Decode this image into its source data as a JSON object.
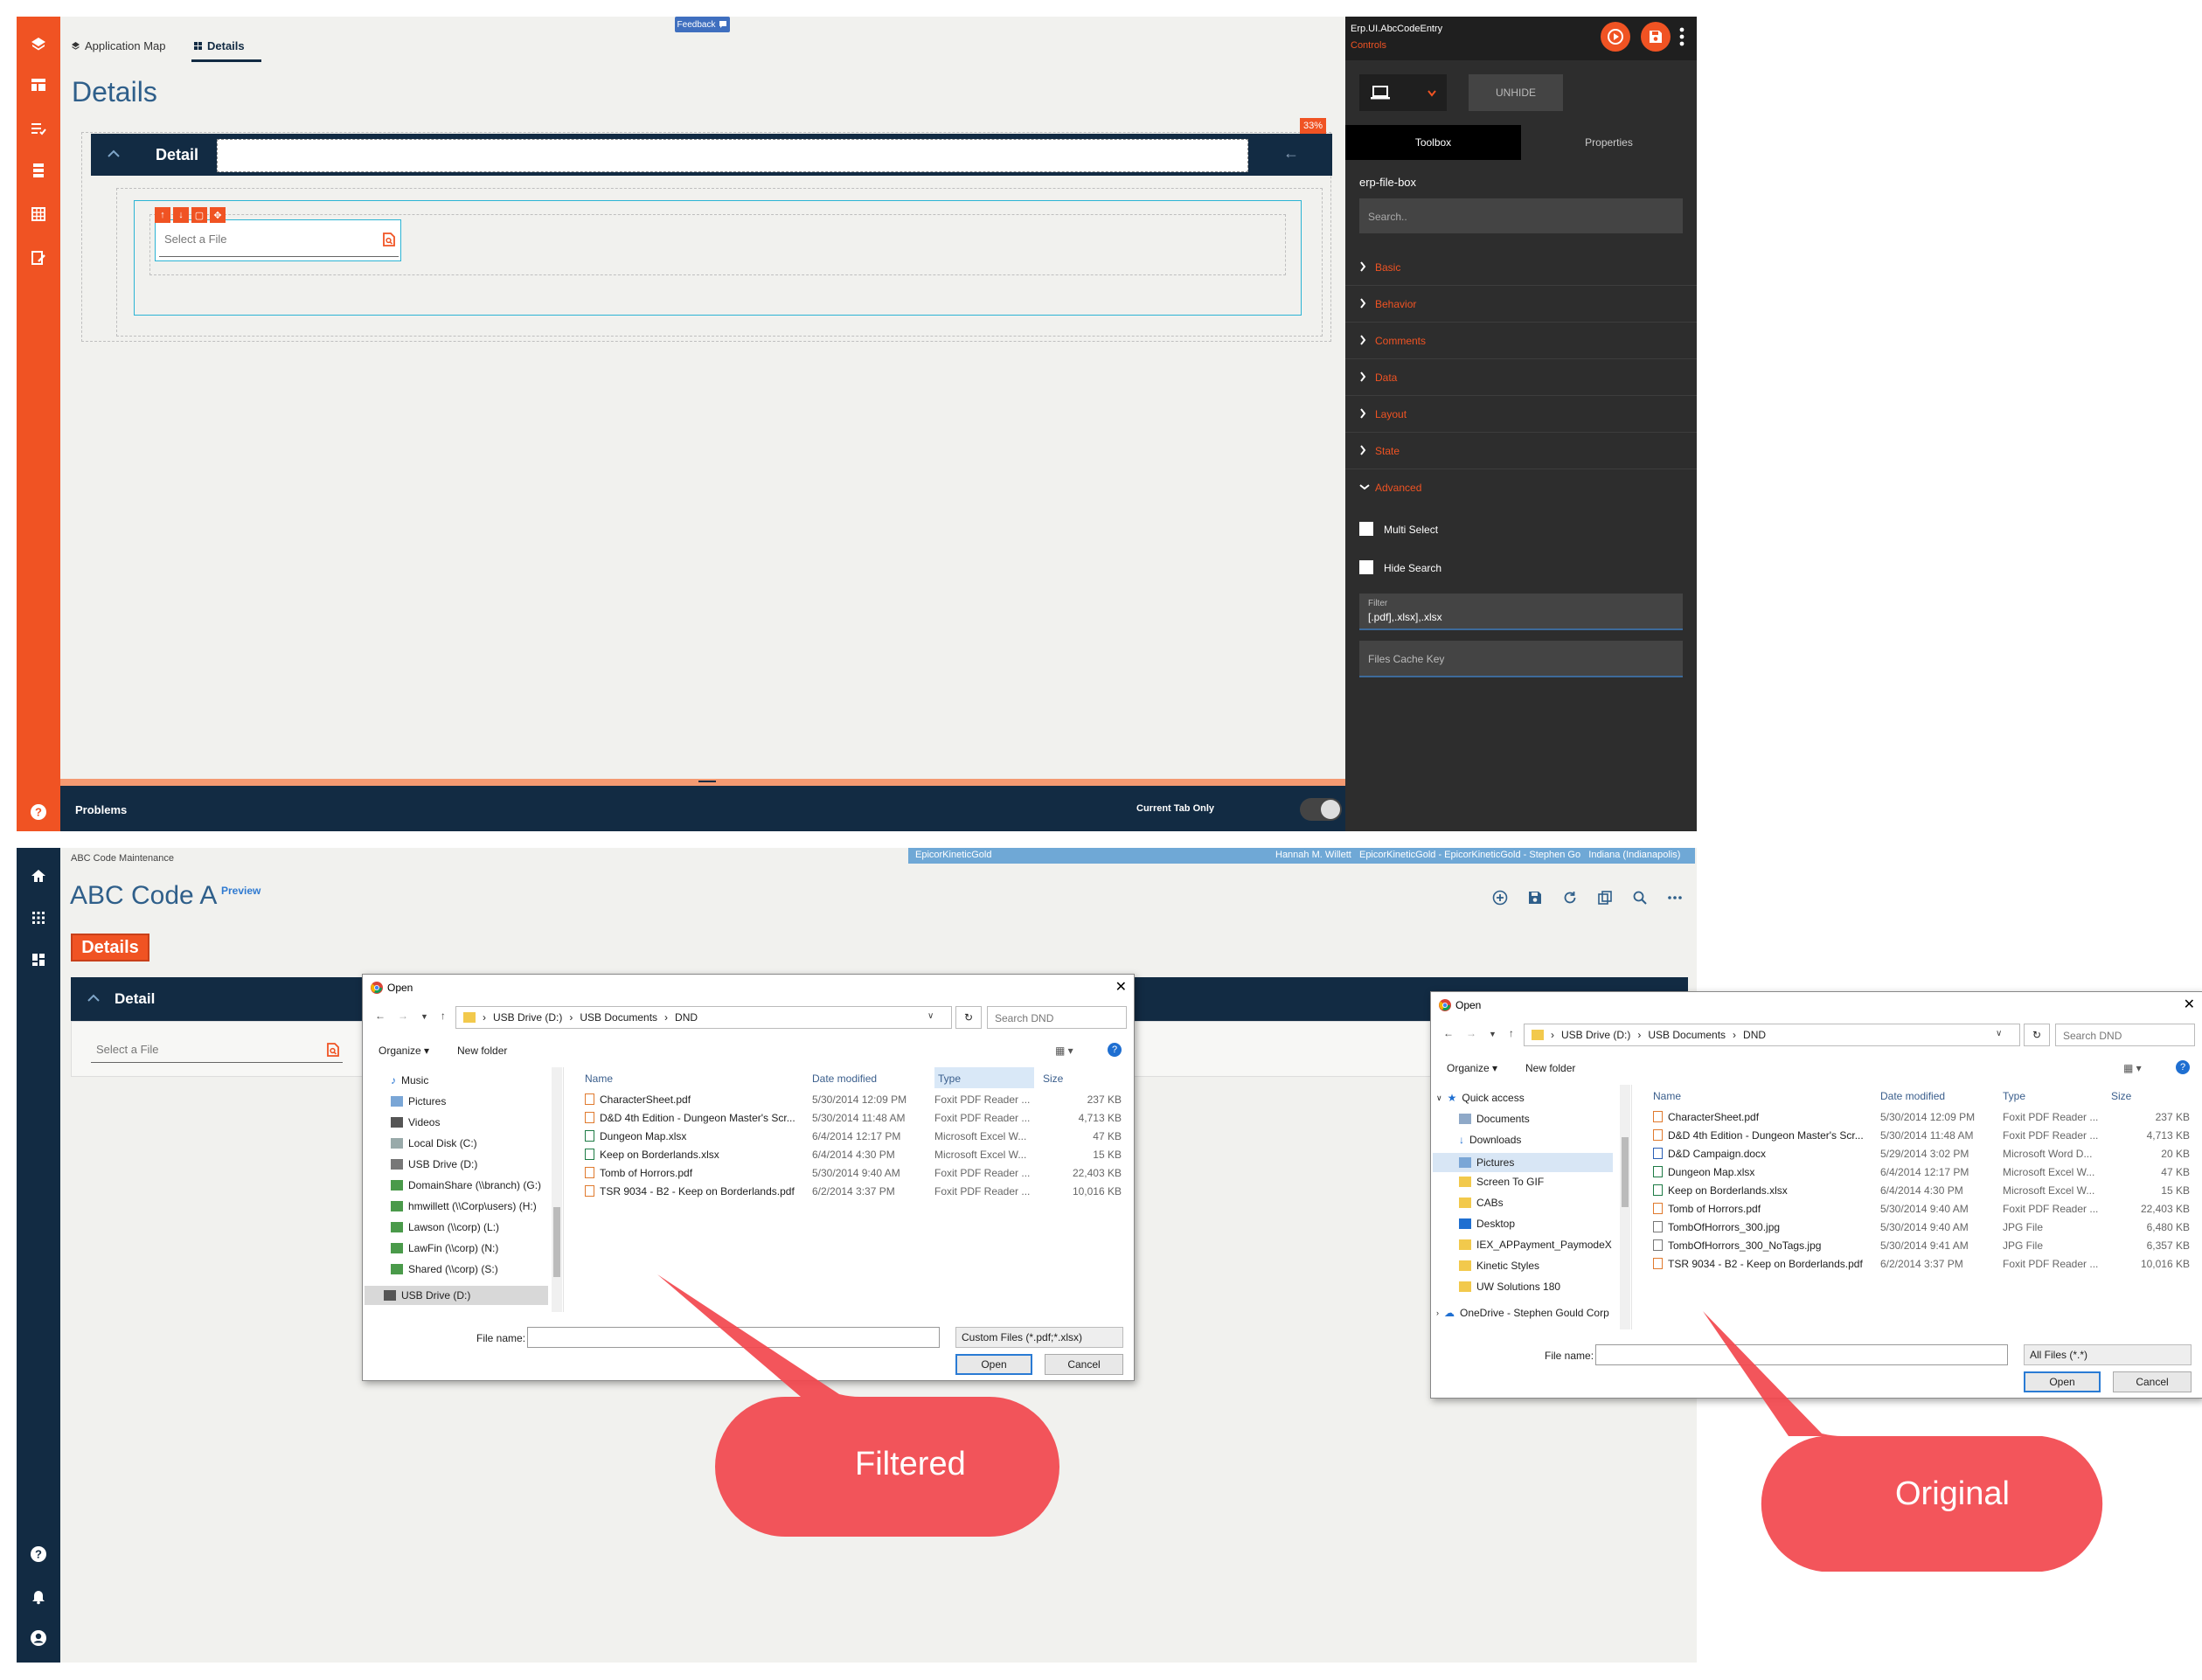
{
  "designer": {
    "breadcrumb_app_map": "Application Map",
    "breadcrumb_details": "Details",
    "feedback_label": "Feedback",
    "page_title": "Details",
    "percent_badge": "33%",
    "detail_panel_label": "Detail",
    "file_box_placeholder": "Select a File",
    "problems_label": "Problems",
    "current_tab_only_label": "Current Tab Only",
    "current_tab_only": false
  },
  "properties": {
    "control_name": "Erp.UI.AbcCodeEntry",
    "subtitle": "Controls",
    "unhide_label": "UNHIDE",
    "tab_toolbox": "Toolbox",
    "tab_properties": "Properties",
    "component_type": "erp-file-box",
    "search_placeholder": "Search..",
    "sections": [
      "Basic",
      "Behavior",
      "Comments",
      "Data",
      "Layout",
      "State",
      "Advanced"
    ],
    "multi_select_label": "Multi Select",
    "hide_search_label": "Hide Search",
    "filter_label": "Filter",
    "filter_value": "[.pdf],.xlsx],.xlsx",
    "files_cache_key_placeholder": "Files Cache Key"
  },
  "app": {
    "breadcrumb": "ABC Code Maintenance",
    "env_strip_left": "EpicorKineticGold",
    "env_strip_right": "Hannah M. Willett   EpicorKineticGold - EpicorKineticGold - Stephen Go   Indiana (Indianapolis)",
    "title": "ABC Code A",
    "preview_label": "Preview",
    "tab_label": "Details",
    "detail_panel_label": "Detail",
    "file_box_placeholder": "Select a File"
  },
  "filtered_dialog": {
    "title": "Open",
    "address": [
      "USB Drive (D:)",
      "USB Documents",
      "DND"
    ],
    "search_placeholder": "Search DND",
    "organize_label": "Organize",
    "new_folder_label": "New folder",
    "nav_items": [
      "Music",
      "Pictures",
      "Videos",
      "Local Disk (C:)",
      "USB Drive (D:)",
      "DomainShare (\\\\branch) (G:)",
      "hmwillett (\\\\Corp\\users) (H:)",
      "Lawson (\\\\corp) (L:)",
      "LawFin (\\\\corp) (N:)",
      "Shared (\\\\corp) (S:)",
      "USB Drive (D:)"
    ],
    "columns": [
      "Name",
      "Date modified",
      "Type",
      "Size"
    ],
    "files": [
      {
        "name": "CharacterSheet.pdf",
        "date": "5/30/2014 12:09 PM",
        "type": "Foxit PDF Reader ...",
        "size": "237 KB",
        "kind": "pdf"
      },
      {
        "name": "D&D 4th Edition - Dungeon Master's Scr...",
        "date": "5/30/2014 11:48 AM",
        "type": "Foxit PDF Reader ...",
        "size": "4,713 KB",
        "kind": "pdf"
      },
      {
        "name": "Dungeon Map.xlsx",
        "date": "6/4/2014 12:17 PM",
        "type": "Microsoft Excel W...",
        "size": "47 KB",
        "kind": "xlsx"
      },
      {
        "name": "Keep on Borderlands.xlsx",
        "date": "6/4/2014 4:30 PM",
        "type": "Microsoft Excel W...",
        "size": "15 KB",
        "kind": "xlsx"
      },
      {
        "name": "Tomb of Horrors.pdf",
        "date": "5/30/2014 9:40 AM",
        "type": "Foxit PDF Reader ...",
        "size": "22,403 KB",
        "kind": "pdf"
      },
      {
        "name": "TSR 9034 - B2 - Keep on Borderlands.pdf",
        "date": "6/2/2014 3:37 PM",
        "type": "Foxit PDF Reader ...",
        "size": "10,016 KB",
        "kind": "pdf"
      }
    ],
    "file_name_label": "File name:",
    "file_type": "Custom Files (*.pdf;*.xlsx)",
    "open_label": "Open",
    "cancel_label": "Cancel"
  },
  "original_dialog": {
    "title": "Open",
    "address": [
      "USB Drive (D:)",
      "USB Documents",
      "DND"
    ],
    "search_placeholder": "Search DND",
    "organize_label": "Organize",
    "new_folder_label": "New folder",
    "nav_items": [
      "Quick access",
      "Documents",
      "Downloads",
      "Pictures",
      "Screen To GIF",
      "CABs",
      "Desktop",
      "IEX_APPayment_PaymodeX",
      "Kinetic Styles",
      "UW Solutions 180",
      "OneDrive - Stephen Gould Corp"
    ],
    "columns": [
      "Name",
      "Date modified",
      "Type",
      "Size"
    ],
    "files": [
      {
        "name": "CharacterSheet.pdf",
        "date": "5/30/2014 12:09 PM",
        "type": "Foxit PDF Reader ...",
        "size": "237 KB",
        "kind": "pdf"
      },
      {
        "name": "D&D 4th Edition - Dungeon Master's Scr...",
        "date": "5/30/2014 11:48 AM",
        "type": "Foxit PDF Reader ...",
        "size": "4,713 KB",
        "kind": "pdf"
      },
      {
        "name": "D&D Campaign.docx",
        "date": "5/29/2014 3:02 PM",
        "type": "Microsoft Word D...",
        "size": "20 KB",
        "kind": "docx"
      },
      {
        "name": "Dungeon Map.xlsx",
        "date": "6/4/2014 12:17 PM",
        "type": "Microsoft Excel W...",
        "size": "47 KB",
        "kind": "xlsx"
      },
      {
        "name": "Keep on Borderlands.xlsx",
        "date": "6/4/2014 4:30 PM",
        "type": "Microsoft Excel W...",
        "size": "15 KB",
        "kind": "xlsx"
      },
      {
        "name": "Tomb of Horrors.pdf",
        "date": "5/30/2014 9:40 AM",
        "type": "Foxit PDF Reader ...",
        "size": "22,403 KB",
        "kind": "pdf"
      },
      {
        "name": "TombOfHorrors_300.jpg",
        "date": "5/30/2014 9:40 AM",
        "type": "JPG File",
        "size": "6,480 KB",
        "kind": "jpg"
      },
      {
        "name": "TombOfHorrors_300_NoTags.jpg",
        "date": "5/30/2014 9:41 AM",
        "type": "JPG File",
        "size": "6,357 KB",
        "kind": "jpg"
      },
      {
        "name": "TSR 9034 - B2 - Keep on Borderlands.pdf",
        "date": "6/2/2014 3:37 PM",
        "type": "Foxit PDF Reader ...",
        "size": "10,016 KB",
        "kind": "pdf"
      }
    ],
    "file_name_label": "File name:",
    "file_type": "All Files (*.*)",
    "open_label": "Open",
    "cancel_label": "Cancel"
  },
  "callouts": {
    "filtered": "Filtered",
    "original": "Original",
    "color": "#f2474d"
  },
  "colors": {
    "accent": "#f05323",
    "navy": "#122b43",
    "title_blue": "#2f5f8a"
  }
}
